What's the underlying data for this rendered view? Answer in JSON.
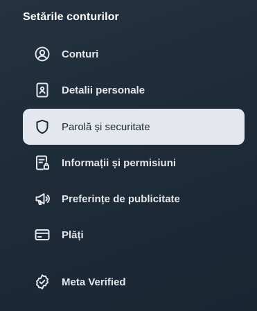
{
  "page": {
    "heading": "Setările conturilor"
  },
  "menu": {
    "items": [
      {
        "label": "Conturi",
        "icon": "account-circle-icon",
        "active": false
      },
      {
        "label": "Detalii personale",
        "icon": "id-badge-icon",
        "active": false
      },
      {
        "label": "Parolă și securitate",
        "icon": "shield-icon",
        "active": true
      },
      {
        "label": "Informații și permisiuni",
        "icon": "document-lock-icon",
        "active": false
      },
      {
        "label": "Preferințe de publicitate",
        "icon": "megaphone-icon",
        "active": false
      },
      {
        "label": "Plăți",
        "icon": "credit-card-icon",
        "active": false
      },
      {
        "label": "Meta Verified",
        "icon": "verified-badge-icon",
        "active": false
      }
    ]
  },
  "colors": {
    "background": "#1e2b39",
    "active_background": "#e4e8ee",
    "text": "#e4e6eb",
    "active_text": "#1c2b33"
  }
}
